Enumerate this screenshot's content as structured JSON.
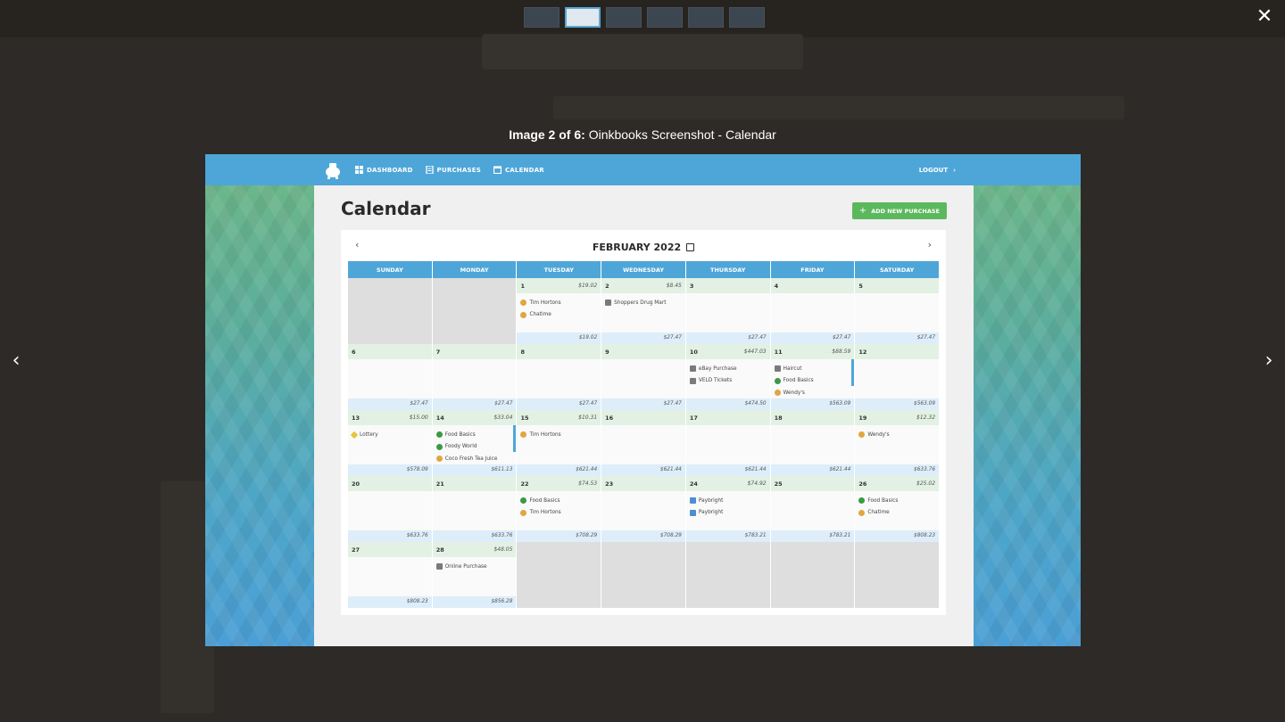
{
  "lightbox": {
    "caption_bold": "Image 2 of 6:",
    "caption_text": "Oinkbooks Screenshot - Calendar",
    "close_glyph": "✕",
    "prev_glyph": "‹",
    "next_glyph": "›",
    "thumbnails": [
      {
        "name": "thumbnail-1",
        "active": false
      },
      {
        "name": "thumbnail-2",
        "active": true
      },
      {
        "name": "thumbnail-3",
        "active": false
      },
      {
        "name": "thumbnail-4",
        "active": false
      },
      {
        "name": "thumbnail-5",
        "active": false
      },
      {
        "name": "thumbnail-6",
        "active": false
      }
    ]
  },
  "app": {
    "nav": {
      "dashboard": "DASHBOARD",
      "purchases": "PURCHASES",
      "calendar": "CALENDAR",
      "logout": "LOGOUT"
    },
    "page_title": "Calendar",
    "add_button": "ADD NEW PURCHASE",
    "month_label": "FEBRUARY 2022",
    "weekdays": [
      "SUNDAY",
      "MONDAY",
      "TUESDAY",
      "WEDNESDAY",
      "THURSDAY",
      "FRIDAY",
      "SATURDAY"
    ],
    "weeks": [
      [
        {
          "empty": true
        },
        {
          "empty": true
        },
        {
          "day": "1",
          "amount": "$19.02",
          "entries": [
            {
              "icon": "burger",
              "label": "Tim Hortons"
            },
            {
              "icon": "burger",
              "label": "Chatime"
            }
          ],
          "total": "$19.02"
        },
        {
          "day": "2",
          "amount": "$8.45",
          "entries": [
            {
              "icon": "cart",
              "label": "Shoppers Drug Mart"
            }
          ],
          "total": "$27.47"
        },
        {
          "day": "3",
          "amount": "",
          "entries": [],
          "total": "$27.47"
        },
        {
          "day": "4",
          "amount": "",
          "entries": [],
          "total": "$27.47"
        },
        {
          "day": "5",
          "amount": "",
          "entries": [],
          "total": "$27.47"
        }
      ],
      [
        {
          "day": "6",
          "amount": "",
          "entries": [],
          "total": "$27.47"
        },
        {
          "day": "7",
          "amount": "",
          "entries": [],
          "total": "$27.47"
        },
        {
          "day": "8",
          "amount": "",
          "entries": [],
          "total": "$27.47"
        },
        {
          "day": "9",
          "amount": "",
          "entries": [],
          "total": "$27.47"
        },
        {
          "day": "10",
          "amount": "$447.03",
          "entries": [
            {
              "icon": "cart",
              "label": "eBay Purchase"
            },
            {
              "icon": "cart",
              "label": "VELD Tickets"
            }
          ],
          "total": "$474.50"
        },
        {
          "day": "11",
          "amount": "$88.59",
          "entries": [
            {
              "icon": "cart",
              "label": "Haircut"
            },
            {
              "icon": "broccoli",
              "label": "Food Basics"
            },
            {
              "icon": "burger",
              "label": "Wendy's"
            }
          ],
          "total": "$563.09",
          "scroll": true
        },
        {
          "day": "12",
          "amount": "",
          "entries": [],
          "total": "$563.09"
        }
      ],
      [
        {
          "day": "13",
          "amount": "$15.00",
          "entries": [
            {
              "icon": "star",
              "label": "Lottery"
            }
          ],
          "total": "$578.09"
        },
        {
          "day": "14",
          "amount": "$33.04",
          "entries": [
            {
              "icon": "broccoli",
              "label": "Food Basics"
            },
            {
              "icon": "broccoli",
              "label": "Foody World"
            },
            {
              "icon": "burger",
              "label": "Coco Fresh Tea Juice"
            }
          ],
          "total": "$611.13",
          "scroll": true
        },
        {
          "day": "15",
          "amount": "$10.31",
          "entries": [
            {
              "icon": "burger",
              "label": "Tim Hortons"
            }
          ],
          "total": "$621.44"
        },
        {
          "day": "16",
          "amount": "",
          "entries": [],
          "total": "$621.44"
        },
        {
          "day": "17",
          "amount": "",
          "entries": [],
          "total": "$621.44"
        },
        {
          "day": "18",
          "amount": "",
          "entries": [],
          "total": "$621.44"
        },
        {
          "day": "19",
          "amount": "$12.32",
          "entries": [
            {
              "icon": "burger",
              "label": "Wendy's"
            }
          ],
          "total": "$633.76"
        }
      ],
      [
        {
          "day": "20",
          "amount": "",
          "entries": [],
          "total": "$633.76"
        },
        {
          "day": "21",
          "amount": "",
          "entries": [],
          "total": "$633.76"
        },
        {
          "day": "22",
          "amount": "$74.53",
          "entries": [
            {
              "icon": "broccoli",
              "label": "Food Basics"
            },
            {
              "icon": "burger",
              "label": "Tim Hortons"
            }
          ],
          "total": "$708.29"
        },
        {
          "day": "23",
          "amount": "",
          "entries": [],
          "total": "$708.29"
        },
        {
          "day": "24",
          "amount": "$74.92",
          "entries": [
            {
              "icon": "square",
              "label": "Paybright"
            },
            {
              "icon": "square",
              "label": "Paybright"
            }
          ],
          "total": "$783.21"
        },
        {
          "day": "25",
          "amount": "",
          "entries": [],
          "total": "$783.21"
        },
        {
          "day": "26",
          "amount": "$25.02",
          "entries": [
            {
              "icon": "broccoli",
              "label": "Food Basics"
            },
            {
              "icon": "burger",
              "label": "Chatime"
            }
          ],
          "total": "$808.23"
        }
      ],
      [
        {
          "day": "27",
          "amount": "",
          "entries": [],
          "total": "$808.23"
        },
        {
          "day": "28",
          "amount": "$48.05",
          "entries": [
            {
              "icon": "cart",
              "label": "Online Purchase"
            }
          ],
          "total": "$856.28"
        },
        {
          "empty": true
        },
        {
          "empty": true
        },
        {
          "empty": true
        },
        {
          "empty": true
        },
        {
          "empty": true
        }
      ]
    ]
  },
  "colors": {
    "nav_blue": "#4ea6d8",
    "add_green": "#5cb85c",
    "day_header_green": "#e2f1e3",
    "day_footer_blue": "#ddeefa"
  }
}
